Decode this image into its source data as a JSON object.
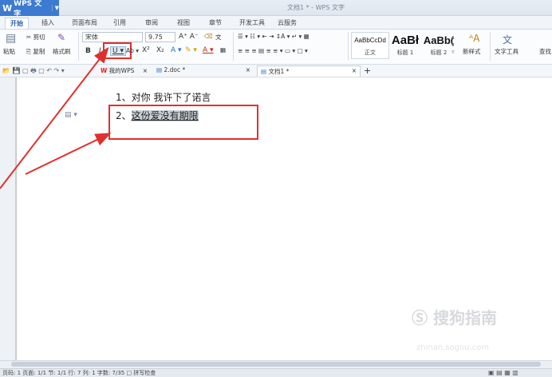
{
  "app": {
    "logo_label": "WPS 文字",
    "window_title": "文档1 * - WPS 文字"
  },
  "tabs": [
    {
      "label": "开始",
      "active": true
    },
    {
      "label": "插入"
    },
    {
      "label": "页面布局"
    },
    {
      "label": "引用"
    },
    {
      "label": "审阅"
    },
    {
      "label": "视图"
    },
    {
      "label": "章节"
    },
    {
      "label": "开发工具"
    },
    {
      "label": "云服务"
    }
  ],
  "ribbon": {
    "paste": "粘贴",
    "cut": "剪切",
    "copy": "复制",
    "format_painter": "格式刷",
    "font_name": "宋体",
    "font_size": "9.75",
    "styles": [
      {
        "sample": "AaBbCcDd",
        "name": "正文"
      },
      {
        "sample": "AaBł",
        "name": "标题 1"
      },
      {
        "sample": "AaBb(",
        "name": "标题 2"
      }
    ],
    "new_style": "新样式",
    "text_tools": "文字工具",
    "find_replace": "查找"
  },
  "doc_tabs": [
    {
      "label": "我的WPS"
    },
    {
      "label": "2.doc *"
    },
    {
      "label": "文档1 *",
      "active": true
    }
  ],
  "document": {
    "line1": "1、对你  我许下了诺言",
    "line2_prefix": "2、",
    "line2_selected": "这份爱没有期限"
  },
  "status": {
    "text": "页码: 1  页面: 1/1  节: 1/1  行: 7  列: 1  字数: 7/35  □ 拼写检查"
  },
  "watermark": {
    "brand": "搜狗指南",
    "url": "zhinan.sogou.com"
  },
  "colors": {
    "annotation": "#e0302e",
    "accent": "#3b7bd0"
  }
}
